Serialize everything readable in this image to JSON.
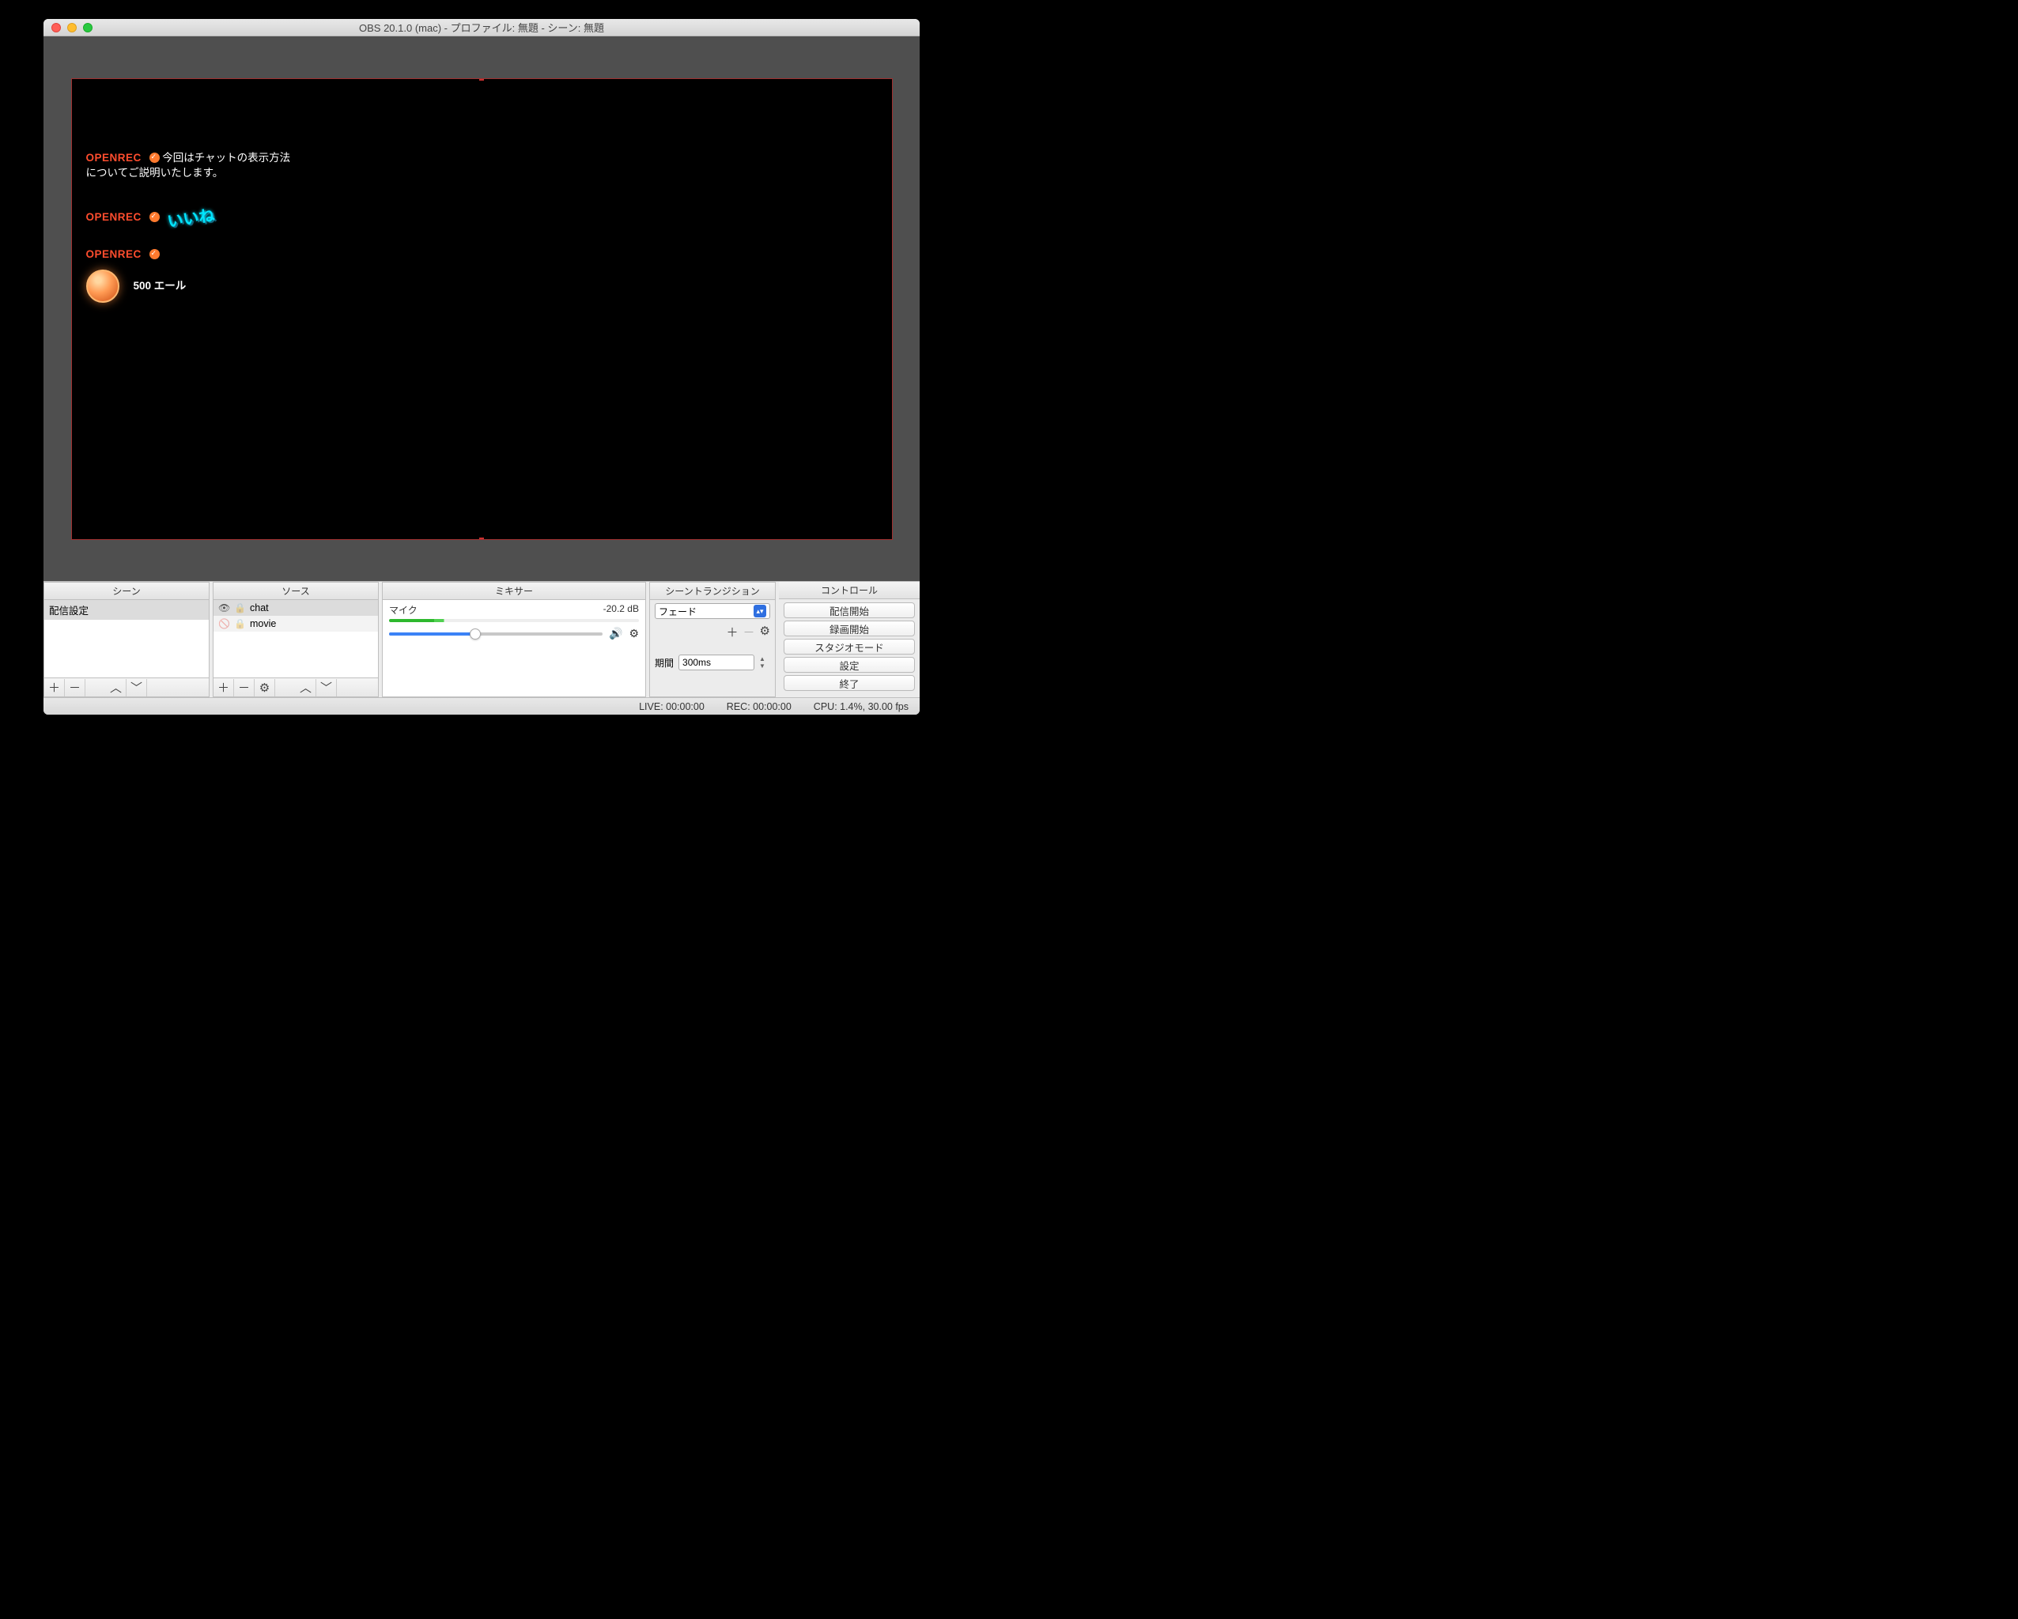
{
  "window": {
    "title": "OBS 20.1.0 (mac) - プロファイル: 無題 - シーン: 無題"
  },
  "chat": {
    "messages": [
      {
        "user": "OPENREC",
        "text": "今回はチャットの表示方法についてご説明いたします。"
      },
      {
        "user": "OPENREC",
        "stamp": "いいね"
      },
      {
        "user": "OPENREC",
        "yell": "500 エール"
      }
    ]
  },
  "panels": {
    "scenes": {
      "title": "シーン",
      "items": [
        "配信設定"
      ]
    },
    "sources": {
      "title": "ソース",
      "items": [
        {
          "name": "chat",
          "visible": true,
          "locked": false
        },
        {
          "name": "movie",
          "visible": false,
          "locked": false
        }
      ]
    },
    "mixer": {
      "title": "ミキサー",
      "channel": {
        "name": "マイク",
        "db": "-20.2 dB"
      }
    },
    "transitions": {
      "title": "シーントランジション",
      "selected": "フェード",
      "duration_label": "期間",
      "duration_value": "300ms"
    },
    "controls": {
      "title": "コントロール",
      "buttons": [
        "配信開始",
        "録画開始",
        "スタジオモード",
        "設定",
        "終了"
      ]
    }
  },
  "status": {
    "live": "LIVE: 00:00:00",
    "rec": "REC: 00:00:00",
    "cpu": "CPU: 1.4%, 30.00 fps"
  }
}
